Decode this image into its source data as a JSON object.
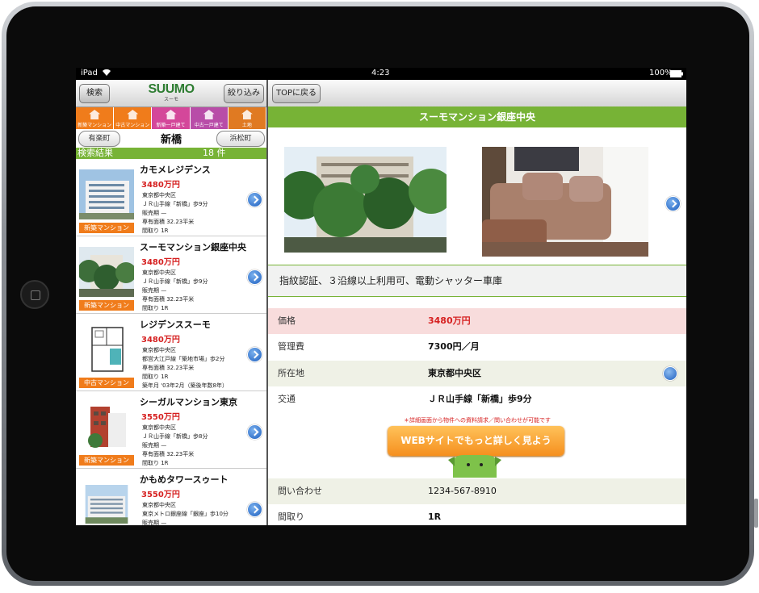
{
  "status_bar": {
    "device": "iPad",
    "time": "4:23",
    "battery": "100%"
  },
  "left_panel": {
    "search_button": "検索",
    "logo_text": "SUUMO",
    "logo_sub": "スーモ",
    "filter_button": "絞り込み",
    "categories": [
      {
        "label": "新築マンション",
        "color": "#f07c1b"
      },
      {
        "label": "中古マンション",
        "color": "#f07c1b"
      },
      {
        "label": "新築一戸建て",
        "color": "#d4479a"
      },
      {
        "label": "中古一戸建て",
        "color": "#b84da8"
      },
      {
        "label": "土地",
        "color": "#e07a22"
      }
    ],
    "station_prev": "有楽町",
    "station_current": "新橋",
    "station_next": "浜松町",
    "results_label": "検索結果",
    "results_count": "18 件",
    "items": [
      {
        "name": "カモメレジデンス",
        "price": "3480万円",
        "details": [
          "東京都中央区",
          "ＪＲ山手線「新橋」歩9分",
          "販売期 —",
          "専有面積 32.23平米",
          "間取り 1R"
        ],
        "tag": "新築マンション"
      },
      {
        "name": "スーモマンション銀座中央",
        "price": "3480万円",
        "details": [
          "東京都中央区",
          "ＪＲ山手線「新橋」歩9分",
          "販売期 —",
          "専有面積 32.23平米",
          "間取り 1R"
        ],
        "tag": "新築マンション"
      },
      {
        "name": "レジデンススーモ",
        "price": "3480万円",
        "details": [
          "東京都中央区",
          "都営大江戸線「築地市場」歩2分",
          "専有面積 32.23平米",
          "間取り 1R",
          "築年月 '03年2月（築後年数8年）"
        ],
        "tag": "中古マンション"
      },
      {
        "name": "シーガルマンション東京",
        "price": "3550万円",
        "details": [
          "東京都中央区",
          "ＪＲ山手線「新橋」歩8分",
          "販売期 —",
          "専有面積 32.23平米",
          "間取り 1R"
        ],
        "tag": "新築マンション"
      },
      {
        "name": "かもめタワースゥート",
        "price": "3550万円",
        "details": [
          "東京都中央区",
          "東京メトロ銀座線「銀座」歩10分",
          "販売期 —"
        ],
        "tag": ""
      }
    ]
  },
  "right_panel": {
    "top_button": "TOPに戻る",
    "title": "スーモマンション銀座中央",
    "description": "指紋認証、３沿線以上利用可、電動シャッター車庫",
    "rows": [
      {
        "label": "価格",
        "value": "3480万円"
      },
      {
        "label": "管理費",
        "value": "7300円／月"
      },
      {
        "label": "所在地",
        "value": "東京都中央区"
      },
      {
        "label": "交通",
        "value": "ＪＲ山手線「新橋」歩9分"
      },
      {
        "label": "問い合わせ",
        "value": "1234-567-8910"
      },
      {
        "label": "間取り",
        "value": "1R"
      }
    ],
    "notice": "＊詳細画面から物件への資料請求／問い合わせが可能です",
    "web_button": "WEBサイトでもっと詳しく見よう"
  },
  "colors": {
    "accent_green": "#77b336",
    "price_red": "#d62020",
    "tag_orange": "#f07c1b"
  }
}
